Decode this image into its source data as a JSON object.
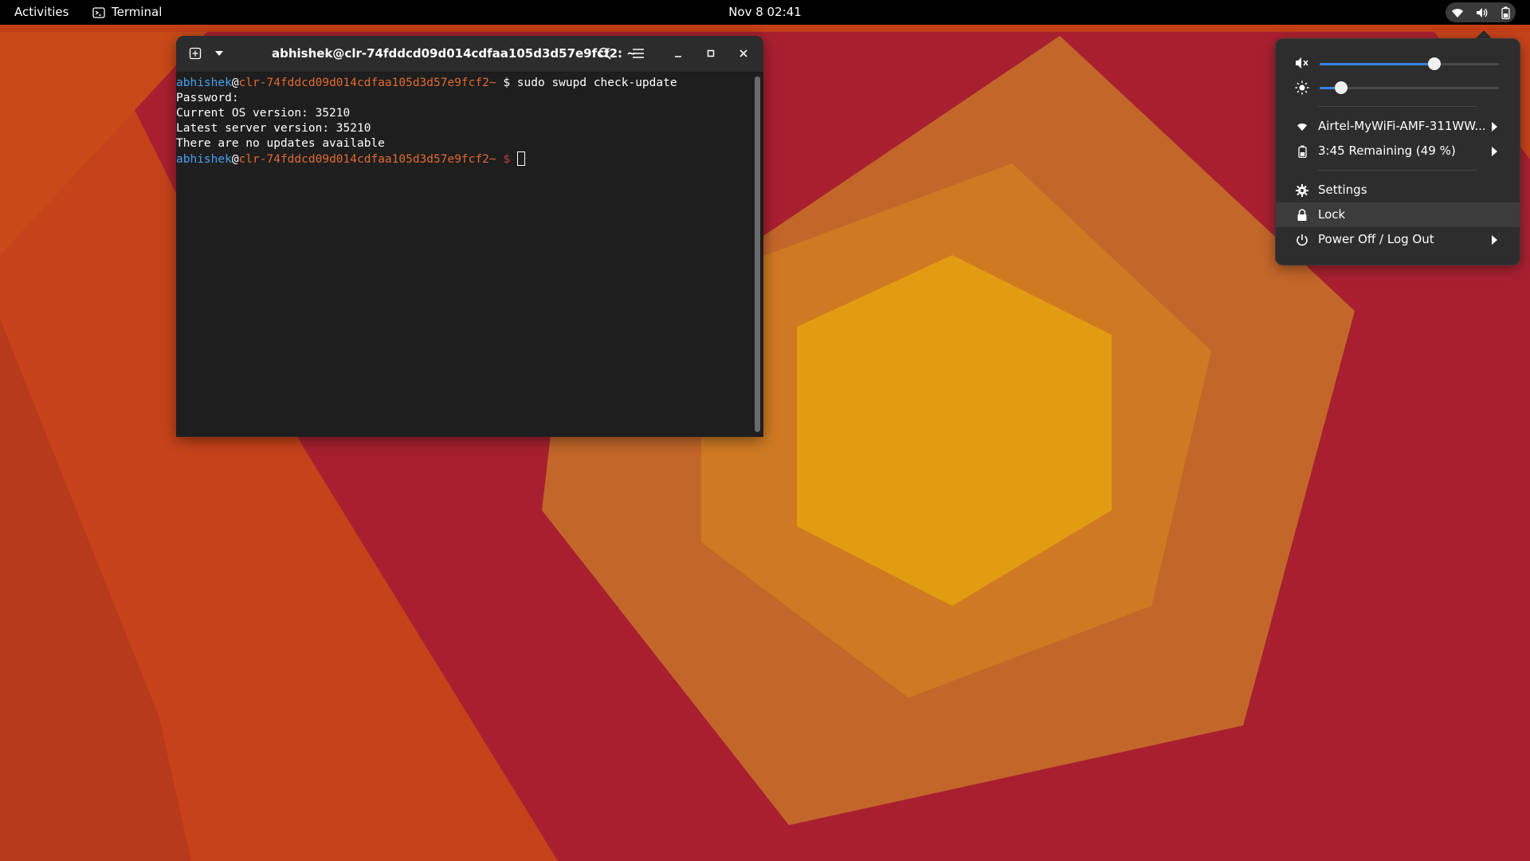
{
  "topbar": {
    "activities": "Activities",
    "app_name": "Terminal",
    "clock": "Nov 8  02:41"
  },
  "terminal": {
    "title": "abhishek@clr-74fddcd09d014cdfaa105d3d57e9fcf2: ~",
    "lines": {
      "l1": {
        "user": "abhishek",
        "host": "clr-74fddcd09d014cdfaa105d3d57e9fcf2",
        "path": "~",
        "prompt": "$",
        "cmd": " sudo swupd check-update"
      },
      "l2": "Password:",
      "l3": "Current OS version: 35210",
      "l4": "Latest server version: 35210",
      "l5": "There are no updates available",
      "l6": {
        "user": "abhishek",
        "host": "clr-74fddcd09d014cdfaa105d3d57e9fcf2",
        "path": "~",
        "prompt": "$"
      }
    }
  },
  "system_menu": {
    "volume_level": 0.64,
    "brightness_level": 0.12,
    "wifi_label": "Airtel-MyWiFi-AMF-311WW...",
    "battery_label": "3:45 Remaining (49 %)",
    "settings_label": "Settings",
    "lock_label": "Lock",
    "power_label": "Power Off / Log Out"
  },
  "colors": {
    "accent": "#3584e4",
    "wallpaper_outer": "#c23d1c",
    "wallpaper_red": "#a82030",
    "wallpaper_mid": "#c46a22",
    "wallpaper_inner": "#e29c12"
  }
}
